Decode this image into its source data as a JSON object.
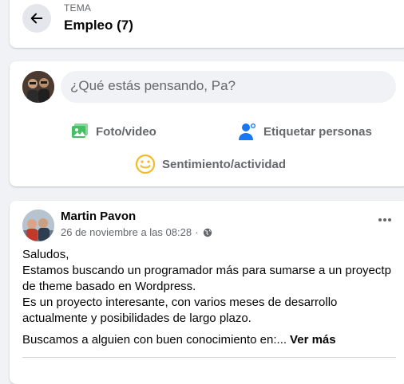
{
  "topic": {
    "kicker": "TEMA",
    "title": "Empleo (7)"
  },
  "composer": {
    "placeholder": "¿Qué estás pensando, Pa?",
    "actions": {
      "photo": "Foto/video",
      "tag": "Etiquetar personas",
      "feeling": "Sentimiento/actividad"
    }
  },
  "post": {
    "author": "Martin Pavon",
    "timestamp": "26 de noviembre a las 08:28",
    "separator": "·",
    "body_lines": [
      "Saludos,",
      "Estamos buscando un programador más para sumarse a un proyectp de theme basado en Wordpress.",
      "Es un proyecto interesante, con varios meses de desarrollo actualmente y posibilidades de largo plazo."
    ],
    "last_line": "Buscamos a alguien con buen conocimiento en:...",
    "see_more": "Ver más"
  },
  "colors": {
    "photo_icon": "#45bd62",
    "tag_icon": "#1877f2",
    "feeling_icon": "#f7b928",
    "secondary_text": "#65676b"
  },
  "icons": {
    "back": "arrow-left-icon",
    "photo": "photo-video-icon",
    "tag": "tag-people-icon",
    "feeling": "smiley-icon",
    "privacy": "globe-icon",
    "more": "more-dots-icon"
  }
}
